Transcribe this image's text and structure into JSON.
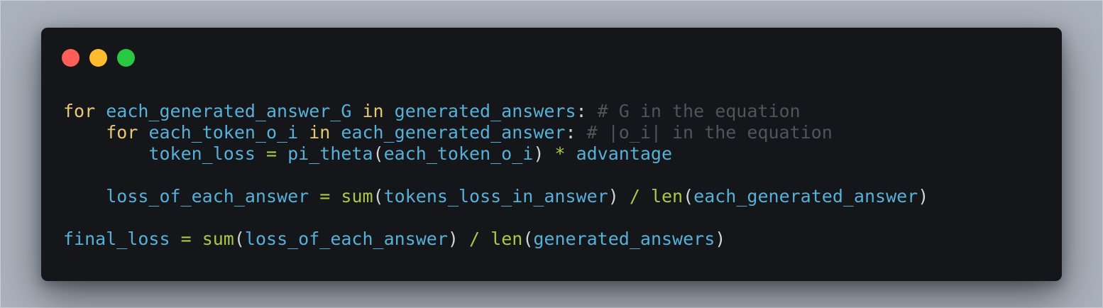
{
  "colors": {
    "page_background": "#aab2bd",
    "window_background": "#141619",
    "close_button": "#fe5f57",
    "minimize_button": "#febc2e",
    "zoom_button": "#28c840",
    "keyword": "#e6c873",
    "identifier": "#56b0d8",
    "operator": "#a8c94a",
    "builtin": "#a8c94a",
    "punctuation": "#d4d4d4",
    "comment": "#4f555c"
  },
  "window_controls": [
    {
      "name": "close-button",
      "color": "#fe5f57"
    },
    {
      "name": "minimize-button",
      "color": "#febc2e"
    },
    {
      "name": "zoom-button",
      "color": "#28c840"
    }
  ],
  "code_lines": [
    [
      {
        "t": "for",
        "k": "keyword"
      },
      {
        "t": " ",
        "k": "punctuation"
      },
      {
        "t": "each_generated_answer_G",
        "k": "identifier"
      },
      {
        "t": " ",
        "k": "punctuation"
      },
      {
        "t": "in",
        "k": "keyword"
      },
      {
        "t": " ",
        "k": "punctuation"
      },
      {
        "t": "generated_answers",
        "k": "identifier"
      },
      {
        "t": ":",
        "k": "punctuation"
      },
      {
        "t": " # G in the equation",
        "k": "comment"
      }
    ],
    [
      {
        "t": "    ",
        "k": "punctuation"
      },
      {
        "t": "for",
        "k": "keyword"
      },
      {
        "t": " ",
        "k": "punctuation"
      },
      {
        "t": "each_token_o_i",
        "k": "identifier"
      },
      {
        "t": " ",
        "k": "punctuation"
      },
      {
        "t": "in",
        "k": "keyword"
      },
      {
        "t": " ",
        "k": "punctuation"
      },
      {
        "t": "each_generated_answer",
        "k": "identifier"
      },
      {
        "t": ":",
        "k": "punctuation"
      },
      {
        "t": " # |o_i| in the equation",
        "k": "comment"
      }
    ],
    [
      {
        "t": "        ",
        "k": "punctuation"
      },
      {
        "t": "token_loss",
        "k": "identifier"
      },
      {
        "t": " ",
        "k": "punctuation"
      },
      {
        "t": "=",
        "k": "operator"
      },
      {
        "t": " ",
        "k": "punctuation"
      },
      {
        "t": "pi_theta",
        "k": "identifier"
      },
      {
        "t": "(",
        "k": "punctuation"
      },
      {
        "t": "each_token_o_i",
        "k": "identifier"
      },
      {
        "t": ")",
        "k": "punctuation"
      },
      {
        "t": " ",
        "k": "punctuation"
      },
      {
        "t": "*",
        "k": "operator"
      },
      {
        "t": " ",
        "k": "punctuation"
      },
      {
        "t": "advantage",
        "k": "identifier"
      }
    ],
    [],
    [
      {
        "t": "    ",
        "k": "punctuation"
      },
      {
        "t": "loss_of_each_answer",
        "k": "identifier"
      },
      {
        "t": " ",
        "k": "punctuation"
      },
      {
        "t": "=",
        "k": "operator"
      },
      {
        "t": " ",
        "k": "punctuation"
      },
      {
        "t": "sum",
        "k": "builtin"
      },
      {
        "t": "(",
        "k": "punctuation"
      },
      {
        "t": "tokens_loss_in_answer",
        "k": "identifier"
      },
      {
        "t": ")",
        "k": "punctuation"
      },
      {
        "t": " ",
        "k": "punctuation"
      },
      {
        "t": "/",
        "k": "operator"
      },
      {
        "t": " ",
        "k": "punctuation"
      },
      {
        "t": "len",
        "k": "builtin"
      },
      {
        "t": "(",
        "k": "punctuation"
      },
      {
        "t": "each_generated_answer",
        "k": "identifier"
      },
      {
        "t": ")",
        "k": "punctuation"
      }
    ],
    [],
    [
      {
        "t": "final_loss",
        "k": "identifier"
      },
      {
        "t": " ",
        "k": "punctuation"
      },
      {
        "t": "=",
        "k": "operator"
      },
      {
        "t": " ",
        "k": "punctuation"
      },
      {
        "t": "sum",
        "k": "builtin"
      },
      {
        "t": "(",
        "k": "punctuation"
      },
      {
        "t": "loss_of_each_answer",
        "k": "identifier"
      },
      {
        "t": ")",
        "k": "punctuation"
      },
      {
        "t": " ",
        "k": "punctuation"
      },
      {
        "t": "/",
        "k": "operator"
      },
      {
        "t": " ",
        "k": "punctuation"
      },
      {
        "t": "len",
        "k": "builtin"
      },
      {
        "t": "(",
        "k": "punctuation"
      },
      {
        "t": "generated_answers",
        "k": "identifier"
      },
      {
        "t": ")",
        "k": "punctuation"
      }
    ]
  ]
}
